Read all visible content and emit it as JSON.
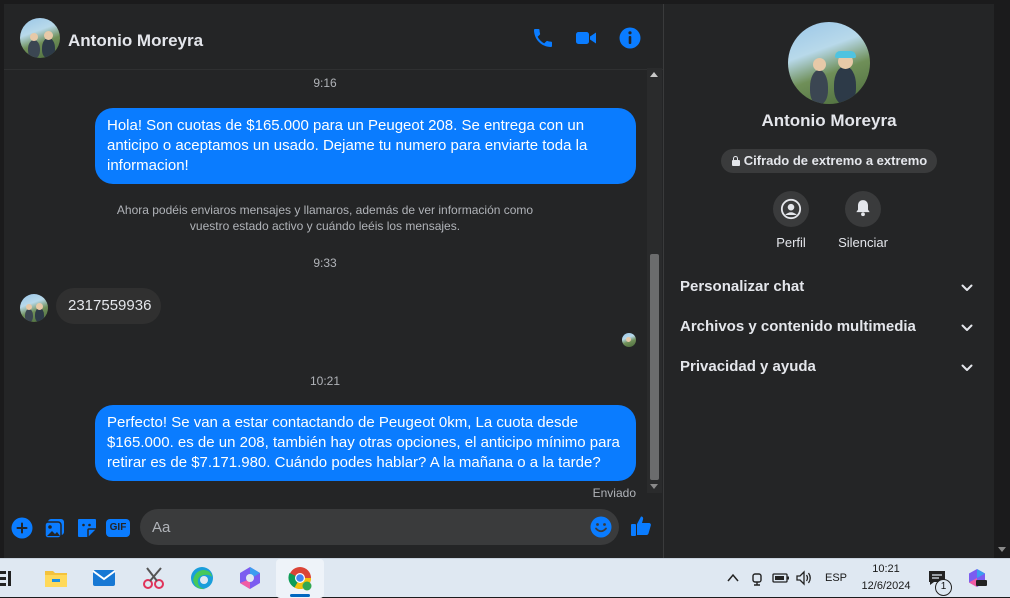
{
  "header": {
    "contact_name": "Antonio Moreyra",
    "icons": [
      "phone-icon",
      "video-icon",
      "info-icon"
    ]
  },
  "accent_color": "#0a7cff",
  "messages": [
    {
      "type": "time",
      "text": "9:16"
    },
    {
      "type": "outgoing",
      "text": "Hola! Son cuotas de $165.000 para un Peugeot 208. Se entrega con un anticipo o aceptamos un usado. Dejame tu numero para enviarte toda la informacion!"
    },
    {
      "type": "notice",
      "text": "Ahora podéis enviaros mensajes y llamaros, además de ver información como vuestro estado activo y cuándo leéis los mensajes."
    },
    {
      "type": "time",
      "text": "9:33"
    },
    {
      "type": "incoming",
      "text": "2317559936"
    },
    {
      "type": "time",
      "text": "10:21"
    },
    {
      "type": "outgoing",
      "text": "Perfecto!  Se van a estar contactando de Peugeot 0km, La cuota desde $165.000. es de un 208, también hay otras opciones, el anticipo mínimo para retirar es de $7.171.980. Cuándo podes hablar? A la mañana o a la tarde?"
    },
    {
      "type": "status",
      "text": "Enviado"
    }
  ],
  "composer": {
    "placeholder": "Aa",
    "icons": [
      "plus-icon",
      "image-icon",
      "sticker-icon",
      "gif-icon",
      "emoji-icon",
      "like-icon"
    ],
    "gif_label": "GIF"
  },
  "sidebar": {
    "name": "Antonio Moreyra",
    "encryption_label": "Cifrado de extremo a extremo",
    "actions": [
      {
        "label": "Perfil",
        "icon": "profile-icon"
      },
      {
        "label": "Silenciar",
        "icon": "bell-icon"
      }
    ],
    "sections": [
      {
        "label": "Personalizar chat"
      },
      {
        "label": "Archivos y contenido multimedia"
      },
      {
        "label": "Privacidad y ayuda"
      }
    ]
  },
  "taskbar": {
    "language": "ESP",
    "time": "10:21",
    "date": "12/6/2024",
    "notification_count": "1",
    "apps": [
      "file-explorer-icon",
      "mail-icon",
      "snipping-tool-icon",
      "edge-icon",
      "copilot-icon",
      "chrome-icon"
    ]
  }
}
